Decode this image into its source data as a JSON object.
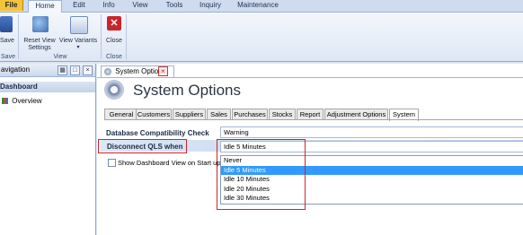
{
  "ribbon_tabs": [
    "File",
    "Home",
    "Edit",
    "Info",
    "View",
    "Tools",
    "Inquiry",
    "Maintenance"
  ],
  "ribbon": {
    "save_label": "Save",
    "reset_view_label_1": "Reset View",
    "reset_view_label_2": "Settings",
    "view_variants_label": "View Variants",
    "close_label": "Close",
    "group_save": "Save",
    "group_view": "View",
    "group_close": "Close"
  },
  "nav": {
    "header": "avigation",
    "section": "Dashboard",
    "item": "Overview",
    "pin_glyph": "□",
    "close_glyph": "×"
  },
  "document": {
    "tab_title": "System Options",
    "heading": "System Options",
    "page_tabs": [
      "General",
      "Customers",
      "Suppliers",
      "Sales",
      "Purchases",
      "Stocks",
      "Report",
      "Adjustment Options",
      "System"
    ],
    "db_compat_label": "Database Compatibility Check",
    "db_compat_value": "Warning",
    "disconnect_label": "Disconnect QLS when",
    "disconnect_value": "Idle 5 Minutes",
    "dropdown_options": [
      "Never",
      "Idle 5 Minutes",
      "Idle 10 Minutes",
      "Idle 20 Minutes",
      "Idle 30 Minutes"
    ],
    "selected_option_index": 1,
    "dashboard_checkbox_label": "Show Dashboard View on Start up",
    "dashboard_checkbox_checked": false
  },
  "colors": {
    "file_tab": "#f3c33a",
    "highlight": "#3399ff",
    "annotation_red": "#d0232a",
    "close_icon": "#c9262b"
  }
}
